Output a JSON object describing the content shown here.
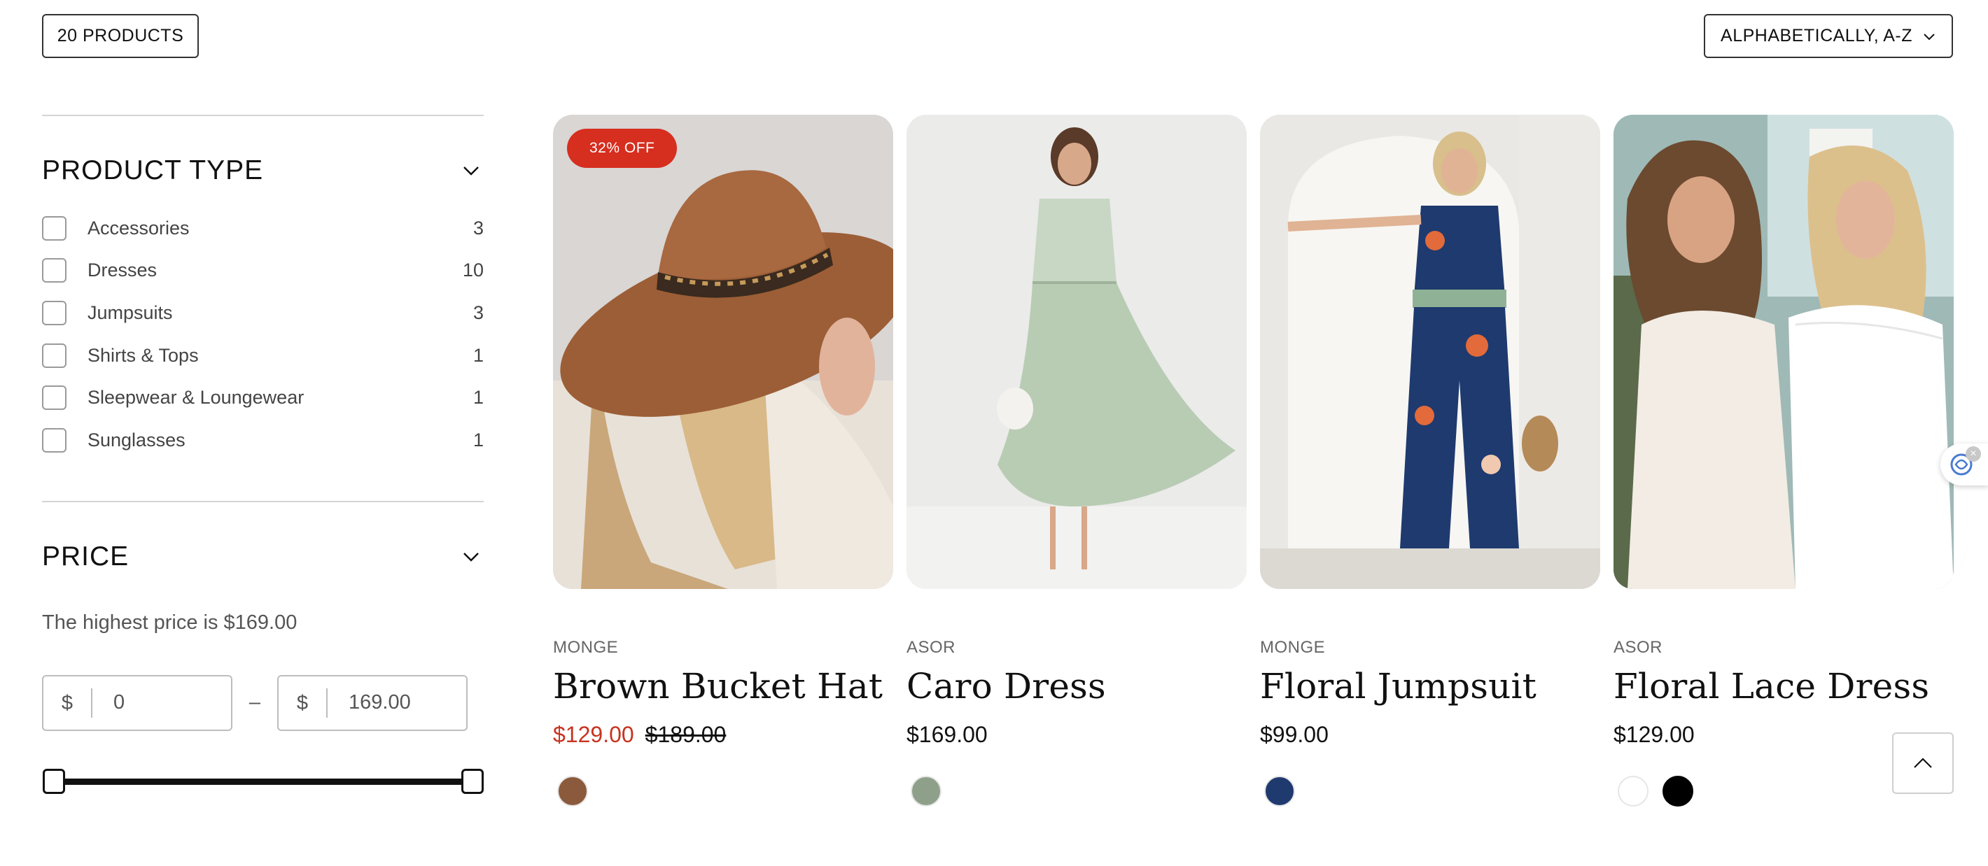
{
  "toolbar": {
    "product_count": "20 PRODUCTS",
    "sort_label": "ALPHABETICALLY, A-Z",
    "sort_icon": "chevron-down-icon"
  },
  "filters": {
    "product_type": {
      "title": "PRODUCT TYPE",
      "items": [
        {
          "label": "Accessories",
          "count": "3",
          "checked": false
        },
        {
          "label": "Dresses",
          "count": "10",
          "checked": false
        },
        {
          "label": "Jumpsuits",
          "count": "3",
          "checked": false
        },
        {
          "label": "Shirts & Tops",
          "count": "1",
          "checked": false
        },
        {
          "label": "Sleepwear & Loungewear",
          "count": "1",
          "checked": false
        },
        {
          "label": "Sunglasses",
          "count": "1",
          "checked": false
        }
      ]
    },
    "price": {
      "title": "PRICE",
      "note": "The highest price is $169.00",
      "currency": "$",
      "separator": "–",
      "min_value": "0",
      "max_value": "169.00",
      "slider_min_fraction": 0,
      "slider_max_fraction": 1
    }
  },
  "products": [
    {
      "badge": "32% OFF",
      "vendor": "MONGE",
      "name": "Brown Bucket Hat",
      "price": "$129.00",
      "compare_price": "$189.00",
      "swatches": [
        "#8b5a3c"
      ]
    },
    {
      "vendor": "ASOR",
      "name": "Caro Dress",
      "price": "$169.00",
      "swatches": [
        "#8fa08a"
      ]
    },
    {
      "vendor": "MONGE",
      "name": "Floral Jumpsuit",
      "price": "$99.00",
      "swatches": [
        "#1f3a6e"
      ]
    },
    {
      "vendor": "ASOR",
      "name": "Floral Lace Dress",
      "price": "$129.00",
      "swatches": [
        "#ffffff",
        "#000000"
      ]
    }
  ],
  "colors": {
    "sale": "#c8331f",
    "badge": "#d62e1f"
  }
}
